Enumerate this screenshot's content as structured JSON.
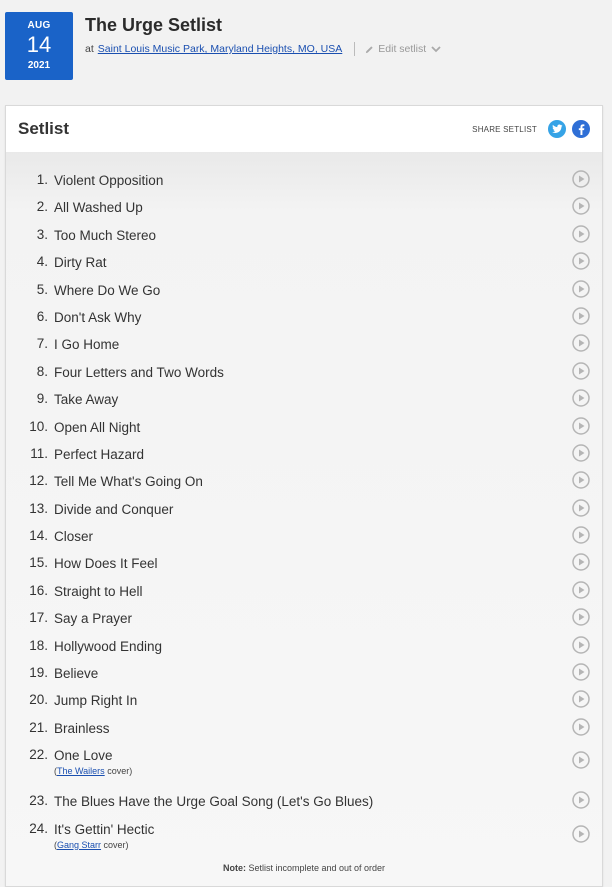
{
  "date": {
    "month": "AUG",
    "day": "14",
    "year": "2021"
  },
  "header": {
    "title": "The Urge Setlist",
    "at_label": "at",
    "venue": "Saint Louis Music Park, Maryland Heights, MO, USA",
    "edit_label": "Edit setlist"
  },
  "setlist": {
    "title": "Setlist",
    "share_label": "SHARE SETLIST",
    "note_label": "Note:",
    "note_text": "Setlist incomplete and out of order",
    "songs": [
      {
        "num": "1.",
        "name": "Violent Opposition"
      },
      {
        "num": "2.",
        "name": "All Washed Up"
      },
      {
        "num": "3.",
        "name": "Too Much Stereo"
      },
      {
        "num": "4.",
        "name": "Dirty Rat"
      },
      {
        "num": "5.",
        "name": "Where Do We Go"
      },
      {
        "num": "6.",
        "name": "Don't Ask Why"
      },
      {
        "num": "7.",
        "name": "I Go Home"
      },
      {
        "num": "8.",
        "name": "Four Letters and Two Words"
      },
      {
        "num": "9.",
        "name": "Take Away"
      },
      {
        "num": "10.",
        "name": "Open All Night"
      },
      {
        "num": "11.",
        "name": "Perfect Hazard"
      },
      {
        "num": "12.",
        "name": "Tell Me What's Going On"
      },
      {
        "num": "13.",
        "name": "Divide and Conquer"
      },
      {
        "num": "14.",
        "name": "Closer"
      },
      {
        "num": "15.",
        "name": "How Does It Feel"
      },
      {
        "num": "16.",
        "name": "Straight to Hell"
      },
      {
        "num": "17.",
        "name": "Say a Prayer"
      },
      {
        "num": "18.",
        "name": "Hollywood Ending"
      },
      {
        "num": "19.",
        "name": "Believe"
      },
      {
        "num": "20.",
        "name": "Jump Right In"
      },
      {
        "num": "21.",
        "name": "Brainless"
      },
      {
        "num": "22.",
        "name": "One Love",
        "cover_open": "(",
        "cover_artist": "The Wailers",
        "cover_suffix": " cover)"
      },
      {
        "num": "23.",
        "name": "The Blues Have the Urge Goal Song (Let's Go Blues)"
      },
      {
        "num": "24.",
        "name": "It's Gettin' Hectic",
        "cover_open": "(",
        "cover_artist": "Gang Starr",
        "cover_suffix": " cover)"
      }
    ]
  },
  "colors": {
    "badge": "#1a63c8",
    "link": "#1a4fb0",
    "twitter": "#36a3e6",
    "facebook": "#2f6fd6"
  },
  "icons": [
    "pencil-icon",
    "chevron-down-icon",
    "twitter-icon",
    "facebook-icon",
    "play-icon"
  ]
}
